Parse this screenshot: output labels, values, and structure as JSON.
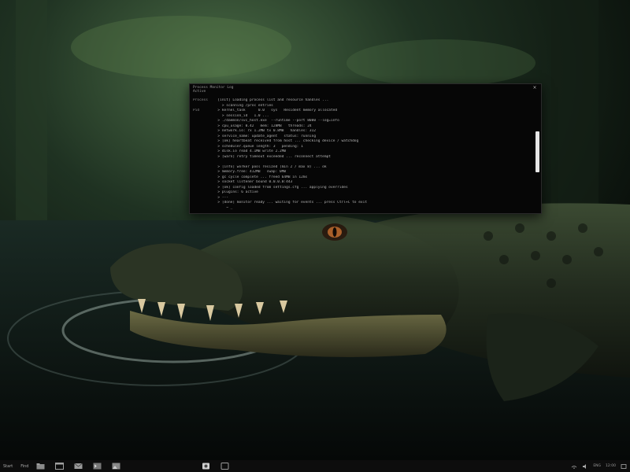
{
  "wallpaper": {
    "subject": "alligator-in-swamp"
  },
  "terminal": {
    "title": "Process Monitor Log\nActive",
    "close_glyph": "×",
    "lines": [
      {
        "prefix": "Process",
        "text": "  [init] Loading process list and resource handles ..."
      },
      {
        "prefix": "",
        "text": "    > scanning /proc entries"
      },
      {
        "prefix": "Pid",
        "text": "  > kernel_task      0.0   sys   Resident memory allocated"
      },
      {
        "prefix": "",
        "text": "    > session_id   1.0 ..."
      },
      {
        "prefix": "",
        "text": "  > ./daemon/svc_host.exe  --runtime --port 8080 --log=info"
      },
      {
        "prefix": "",
        "text": "  > cpu_usage: 0.42   mem: 128MB   threads: 24"
      },
      {
        "prefix": "",
        "text": "  > network.io: rx 1.2MB tx 0.8MB   handles: 312"
      },
      {
        "prefix": "",
        "text": "  > service_name: update_agent   status: running"
      },
      {
        "prefix": "",
        "text": "  > [ok] heartbeat received from host ... checking device / watchdog"
      },
      {
        "prefix": "",
        "text": "  > scheduler.queue length: 3   pending: 1"
      },
      {
        "prefix": "",
        "text": "  > disk.io read 4.1MB write 2.2MB"
      },
      {
        "prefix": "",
        "text": "  > [warn] retry timeout exceeded ... reconnect attempt"
      },
      {
        "prefix": "",
        "text": ""
      },
      {
        "prefix": "",
        "text": "  > [info] worker pool resized (min 2 / max 8) ... ok"
      },
      {
        "prefix": "",
        "text": "  > memory.free: 412MB   swap: 0MB"
      },
      {
        "prefix": "",
        "text": "  > gc cycle complete ... freed 64MB in 12ms"
      },
      {
        "prefix": "",
        "text": "  > socket listener bound 0.0.0.0:443"
      },
      {
        "prefix": "",
        "text": "  > [ok] config loaded from settings.cfg ... applying overrides"
      },
      {
        "prefix": "",
        "text": "  > plugins: 6 active"
      },
      {
        "prefix": "",
        "text": "  > ---"
      },
      {
        "prefix": "",
        "text": "  > [done] monitor ready ... waiting for events ... press Ctrl+C to exit"
      },
      {
        "prefix": "",
        "text": "      ~ _"
      }
    ]
  },
  "taskbar": {
    "start_label": "Start",
    "search_label": "Find",
    "apps": [
      {
        "icon": "file-explorer-icon"
      },
      {
        "icon": "browser-icon"
      },
      {
        "icon": "mail-icon"
      },
      {
        "icon": "terminal-icon"
      },
      {
        "icon": "photos-icon"
      }
    ],
    "tray": {
      "items": [
        "ENG",
        "12:00"
      ],
      "icons": [
        "network-icon",
        "volume-icon",
        "notification-icon"
      ]
    }
  }
}
